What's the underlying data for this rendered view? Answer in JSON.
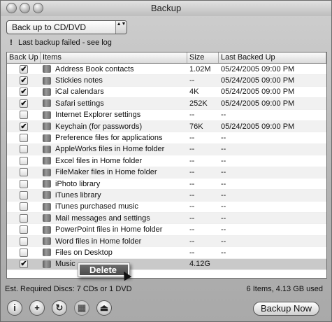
{
  "window": {
    "title": "Backup"
  },
  "popup": {
    "selected": "Back up to CD/DVD",
    "arrows": "▲▼"
  },
  "warning": {
    "icon": "!",
    "text": "Last backup failed - see log"
  },
  "table": {
    "headers": [
      "Back Up",
      "Items",
      "Size",
      "Last Backed Up"
    ],
    "rows": [
      {
        "checked": true,
        "check_mark": "✔",
        "item": "Address Book contacts",
        "size": "1.02M",
        "date": "05/24/2005 09:00 PM"
      },
      {
        "checked": true,
        "check_mark": "✔",
        "item": "Stickies notes",
        "size": "--",
        "date": "05/24/2005 09:00 PM"
      },
      {
        "checked": true,
        "check_mark": "✔",
        "item": "iCal calendars",
        "size": "4K",
        "date": "05/24/2005 09:00 PM"
      },
      {
        "checked": true,
        "check_mark": "✔",
        "item": "Safari settings",
        "size": "252K",
        "date": "05/24/2005 09:00 PM"
      },
      {
        "checked": false,
        "check_mark": "",
        "item": "Internet Explorer settings",
        "size": "--",
        "date": "--"
      },
      {
        "checked": true,
        "check_mark": "✔",
        "item": "Keychain (for passwords)",
        "size": "76K",
        "date": "05/24/2005 09:00 PM"
      },
      {
        "checked": false,
        "check_mark": "",
        "item": "Preference files for applications",
        "size": "--",
        "date": "--"
      },
      {
        "checked": false,
        "check_mark": "",
        "item": "AppleWorks files in Home folder",
        "size": "--",
        "date": "--"
      },
      {
        "checked": false,
        "check_mark": "",
        "item": "Excel files in Home folder",
        "size": "--",
        "date": "--"
      },
      {
        "checked": false,
        "check_mark": "",
        "item": "FileMaker files in Home folder",
        "size": "--",
        "date": "--"
      },
      {
        "checked": false,
        "check_mark": "",
        "item": "iPhoto library",
        "size": "--",
        "date": "--"
      },
      {
        "checked": false,
        "check_mark": "",
        "item": "iTunes library",
        "size": "--",
        "date": "--"
      },
      {
        "checked": false,
        "check_mark": "",
        "item": "iTunes purchased music",
        "size": "--",
        "date": "--"
      },
      {
        "checked": false,
        "check_mark": "",
        "item": "Mail messages and settings",
        "size": "--",
        "date": "--"
      },
      {
        "checked": false,
        "check_mark": "",
        "item": "PowerPoint files in Home folder",
        "size": "--",
        "date": "--"
      },
      {
        "checked": false,
        "check_mark": "",
        "item": "Word files in Home folder",
        "size": "--",
        "date": "--"
      },
      {
        "checked": false,
        "check_mark": "",
        "item": "Files on Desktop",
        "size": "--",
        "date": "--"
      },
      {
        "checked": true,
        "check_mark": "✔",
        "item": "Music",
        "size": "4.12G",
        "date": ""
      }
    ]
  },
  "context_menu": {
    "item": "Delete"
  },
  "status": {
    "left": "Est. Required Discs: 7 CDs or 1 DVD",
    "right": "6 Items, 4.13 GB used"
  },
  "toolbar": {
    "info_icon": "i",
    "add_icon": "+",
    "refresh_icon": "↻",
    "calendar_icon": "▦",
    "eject_icon": "⏏",
    "backup_now": "Backup Now"
  }
}
